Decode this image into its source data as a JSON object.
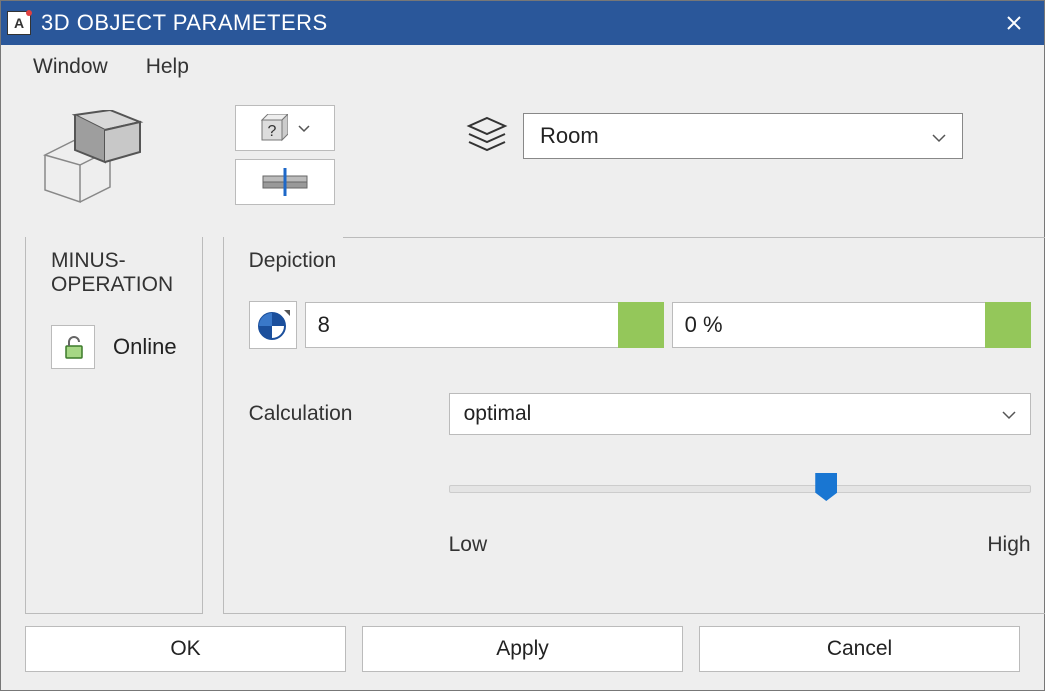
{
  "titlebar": {
    "title": "3D OBJECT PARAMETERS",
    "app_icon_letter": "A"
  },
  "menubar": {
    "window": "Window",
    "help": "Help"
  },
  "layer": {
    "selected": "Room"
  },
  "minus_op": {
    "title": "MINUS-OPERATION",
    "lock_label": "Online"
  },
  "depiction": {
    "title": "Depiction",
    "input1": "8",
    "input2": "0 %",
    "calc_label": "Calculation",
    "calc_selected": "optimal",
    "slider_low": "Low",
    "slider_high": "High",
    "slider_value": 63
  },
  "buttons": {
    "ok": "OK",
    "apply": "Apply",
    "cancel": "Cancel"
  }
}
